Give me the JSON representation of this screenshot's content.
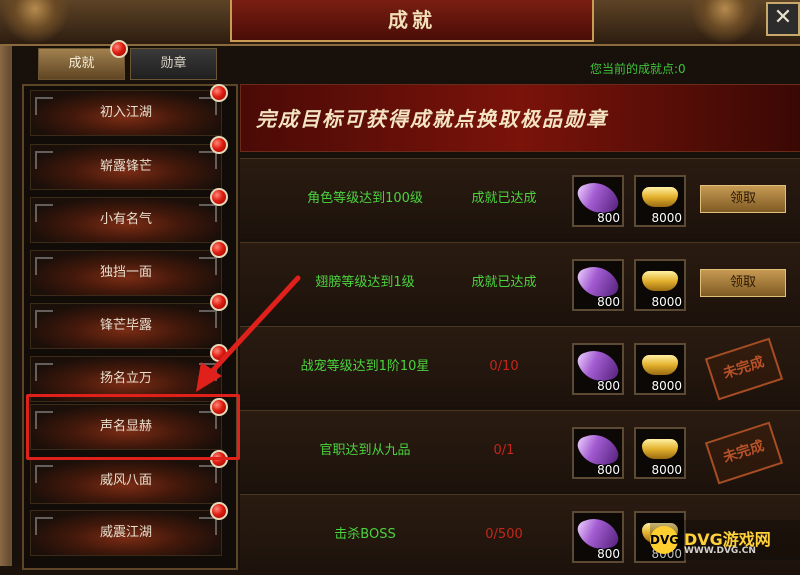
{
  "window": {
    "title": "成就",
    "close_label": "✕"
  },
  "tabs": [
    {
      "label": "成就",
      "active": true
    },
    {
      "label": "勋章",
      "active": false
    }
  ],
  "points_label": "您当前的成就点:0",
  "banner_text": "完成目标可获得成就点换取极品勋章",
  "sidebar": {
    "items": [
      {
        "label": "初入江湖"
      },
      {
        "label": "崭露锋芒"
      },
      {
        "label": "小有名气"
      },
      {
        "label": "独挡一面"
      },
      {
        "label": "锋芒毕露"
      },
      {
        "label": "扬名立万"
      },
      {
        "label": "声名显赫",
        "highlighted": true
      },
      {
        "label": "威风八面"
      },
      {
        "label": "威震江湖"
      }
    ]
  },
  "tasks": [
    {
      "name": "角色等级达到100级",
      "status": "成就已达成",
      "status_type": "done",
      "reward1": "800",
      "reward2": "8000",
      "action": "领取"
    },
    {
      "name": "翅膀等级达到1级",
      "status": "成就已达成",
      "status_type": "done",
      "reward1": "800",
      "reward2": "8000",
      "action": "领取"
    },
    {
      "name": "战宠等级达到1阶10星",
      "status": "0/10",
      "status_type": "progress",
      "reward1": "800",
      "reward2": "8000",
      "stamp": "未完成"
    },
    {
      "name": "官职达到从九品",
      "status": "0/1",
      "status_type": "progress",
      "reward1": "800",
      "reward2": "8000",
      "stamp": "未完成"
    },
    {
      "name": "击杀BOSS",
      "status": "0/500",
      "status_type": "progress",
      "reward1": "800",
      "reward2": "8000"
    }
  ],
  "watermark": {
    "logo": "DVG",
    "text": "DVG游戏网",
    "url": "WWW.DVG.CN"
  },
  "colors": {
    "accent_green": "#4bd33e",
    "progress_red": "#c3271b",
    "highlight_red": "#e0201b"
  }
}
